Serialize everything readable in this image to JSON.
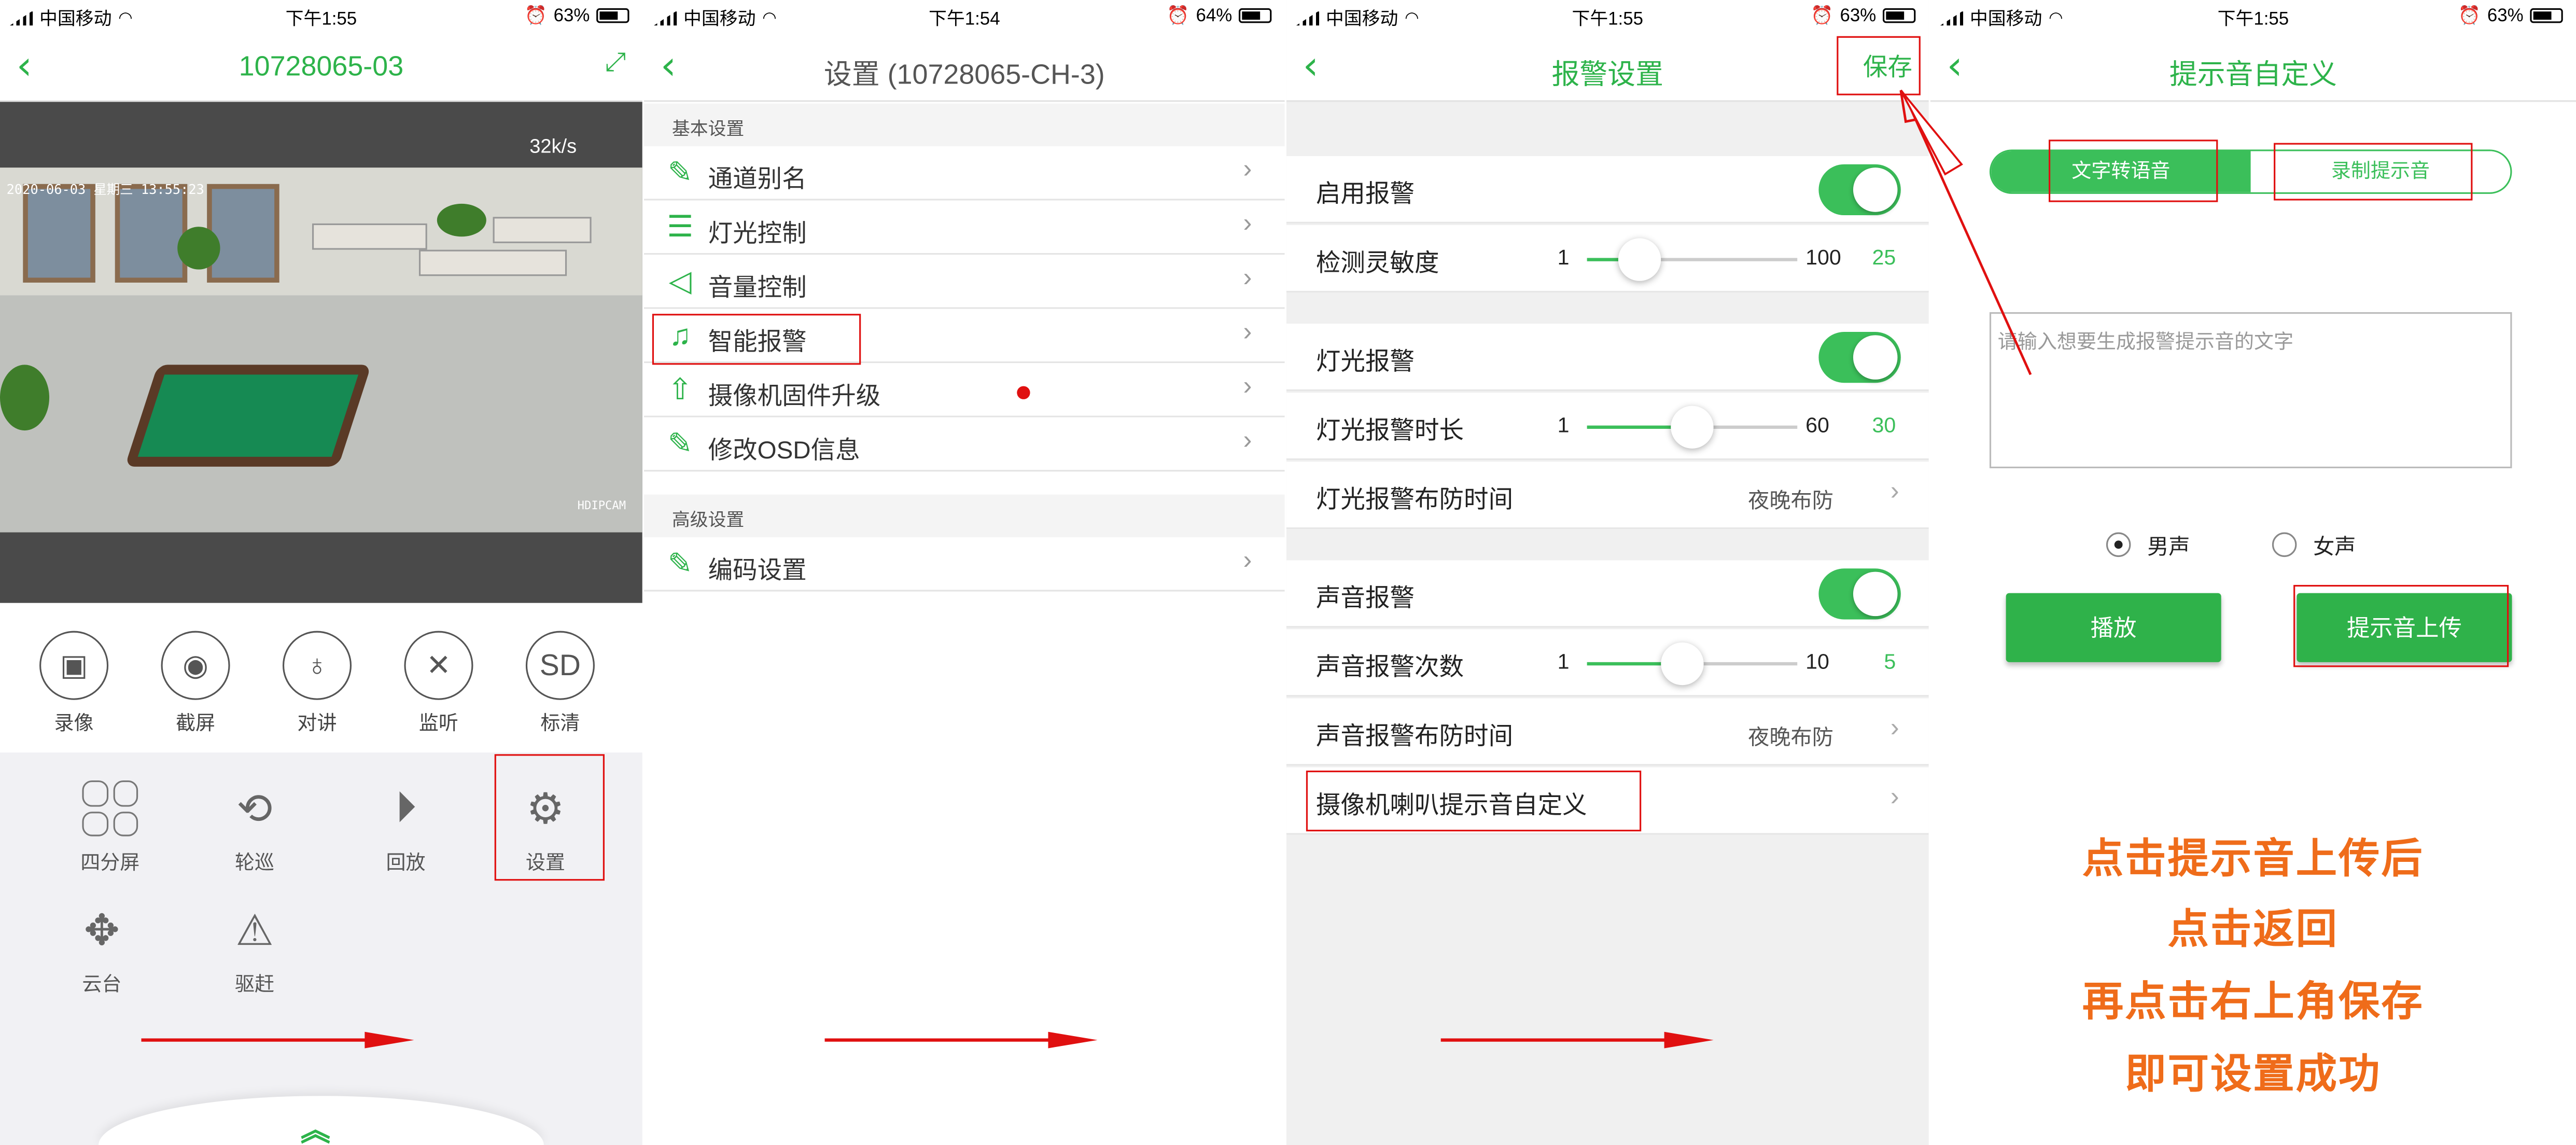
{
  "status": [
    {
      "carrier": "中国移动",
      "time": "下午1:55",
      "battery": "63%"
    },
    {
      "carrier": "中国移动",
      "time": "下午1:54",
      "battery": "64%"
    },
    {
      "carrier": "中国移动",
      "time": "下午1:55",
      "battery": "63%"
    },
    {
      "carrier": "中国移动",
      "time": "下午1:55",
      "battery": "63%"
    }
  ],
  "live": {
    "title": "10728065-03",
    "rate": "32k/s",
    "timestamp": "2020-06-03 星期三 13:55:23",
    "brand": "HDIPCAM",
    "controls": [
      "录像",
      "截屏",
      "对讲",
      "监听",
      "标清"
    ],
    "sd_text": "SD",
    "menu": [
      "四分屏",
      "轮巡",
      "回放",
      "设置",
      "云台",
      "驱赶"
    ]
  },
  "settings": {
    "title": "设置 (10728065-CH-3)",
    "basic_header": "基本设置",
    "basic_items": [
      "通道别名",
      "灯光控制",
      "音量控制",
      "智能报警",
      "摄像机固件升级",
      "修改OSD信息"
    ],
    "advanced_header": "高级设置",
    "advanced_items": [
      "编码设置"
    ]
  },
  "alarm": {
    "title": "报警设置",
    "save": "保存",
    "enable": "启用报警",
    "sensitivity": {
      "label": "检测灵敏度",
      "min": "1",
      "max": "100",
      "value": "25",
      "ratio": 0.25
    },
    "light": "灯光报警",
    "light_duration": {
      "label": "灯光报警时长",
      "min": "1",
      "max": "60",
      "value": "30",
      "ratio": 0.5
    },
    "light_schedule": {
      "label": "灯光报警布防时间",
      "value": "夜晚布防"
    },
    "sound": "声音报警",
    "sound_count": {
      "label": "声音报警次数",
      "min": "1",
      "max": "10",
      "value": "5",
      "ratio": 0.45
    },
    "sound_schedule": {
      "label": "声音报警布防时间",
      "value": "夜晚布防"
    },
    "custom_tone": "摄像机喇叭提示音自定义"
  },
  "tone": {
    "title": "提示音自定义",
    "tab_tts": "文字转语音",
    "tab_record": "录制提示音",
    "placeholder": "请输入想要生成报警提示音的文字",
    "male": "男声",
    "female": "女声",
    "play": "播放",
    "upload": "提示音上传",
    "instructions": [
      "点击提示音上传后",
      "点击返回",
      "再点击右上角保存",
      "即可设置成功"
    ]
  },
  "colors": {
    "accent": "#2db34a",
    "highlight": "#e01010",
    "instruction": "#ef6c1a"
  }
}
